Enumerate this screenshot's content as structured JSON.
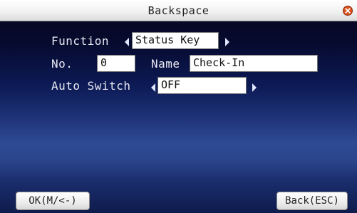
{
  "window": {
    "title": "Backspace"
  },
  "form": {
    "function_label": "Function",
    "function_value": "Status Key",
    "no_label": "No.",
    "no_value": "0",
    "name_label": "Name",
    "name_value": "Check-In",
    "auto_switch_label": "Auto Switch",
    "auto_switch_value": "OFF"
  },
  "buttons": {
    "ok_label": "OK(M/<-)",
    "back_label": "Back(ESC)"
  },
  "icons": {
    "close": "close-icon",
    "left_arrow": "arrow-left-icon",
    "right_arrow": "arrow-right-icon"
  },
  "colors": {
    "background_dark": "#05061a",
    "background_mid": "#2d4a93",
    "label_text": "#e8e8f2",
    "close_icon": "#d9531e"
  }
}
